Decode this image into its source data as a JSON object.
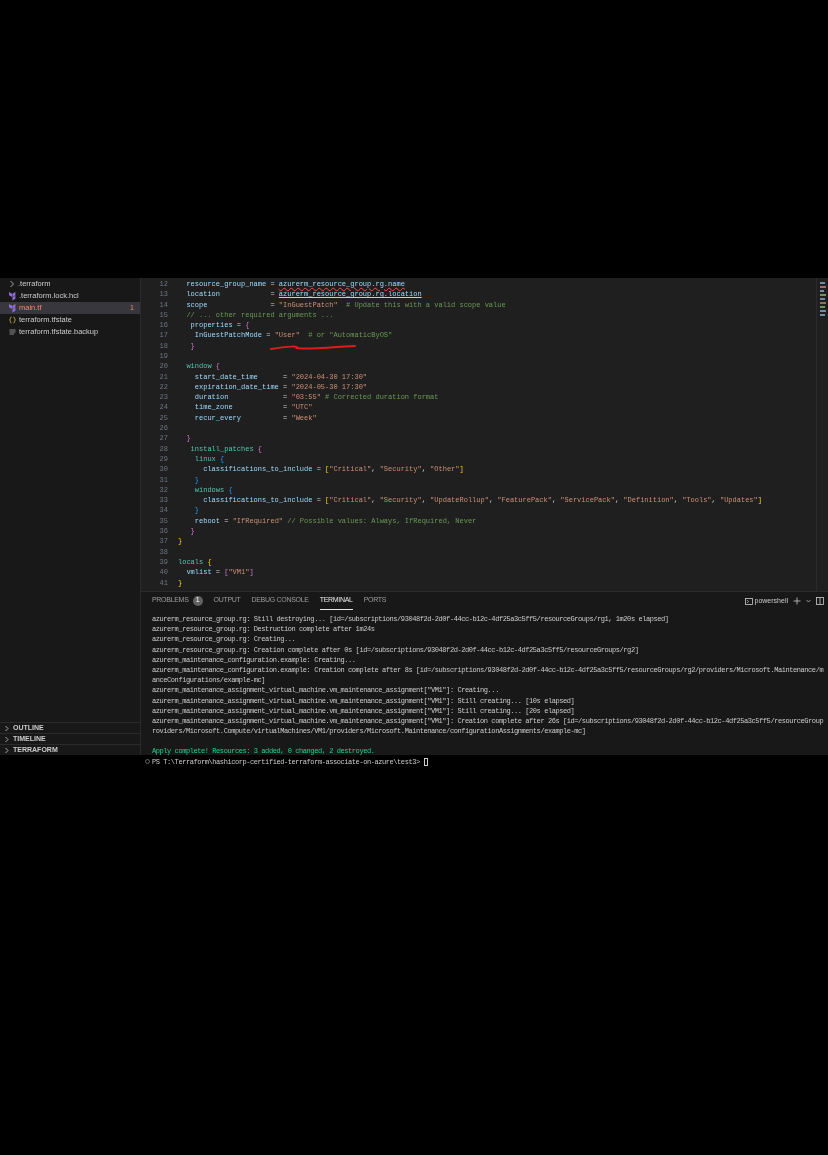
{
  "explorer": {
    "items": [
      {
        "name": ".terraform",
        "kind": "folder",
        "selected": false,
        "error": false
      },
      {
        "name": ".terraform.lock.hcl",
        "kind": "terraform",
        "selected": false,
        "error": false
      },
      {
        "name": "main.tf",
        "kind": "terraform",
        "selected": true,
        "error": true,
        "badge": "1"
      },
      {
        "name": "terraform.tfstate",
        "kind": "json",
        "selected": false,
        "error": false
      },
      {
        "name": "terraform.tfstate.backup",
        "kind": "text",
        "selected": false,
        "error": false
      }
    ]
  },
  "sections": [
    {
      "label": "OUTLINE",
      "expanded": false
    },
    {
      "label": "TIMELINE",
      "expanded": false
    },
    {
      "label": "TERRAFORM",
      "expanded": false
    }
  ],
  "editor": {
    "lines": [
      {
        "number": "12",
        "tokens": [
          {
            "kind": "attr",
            "text": "  resource_group_name "
          },
          {
            "kind": "op",
            "text": "= "
          },
          {
            "kind": "ref_error",
            "text": "azurerm_resource_group.rg.name"
          }
        ]
      },
      {
        "number": "13",
        "tokens": [
          {
            "kind": "attr",
            "text": "  location            "
          },
          {
            "kind": "op",
            "text": "= "
          },
          {
            "kind": "ref",
            "text": "azurerm_resource_group.rg.location"
          }
        ]
      },
      {
        "number": "14",
        "tokens": [
          {
            "kind": "attr",
            "text": "  scope               "
          },
          {
            "kind": "op",
            "text": "= "
          },
          {
            "kind": "string",
            "text": "\"InGuestPatch\""
          },
          {
            "kind": "comment",
            "text": "  # Update this with a valid scope value"
          }
        ]
      },
      {
        "number": "15",
        "tokens": [
          {
            "kind": "comment",
            "text": "  // ... other required arguments ..."
          }
        ]
      },
      {
        "number": "16",
        "tokens": [
          {
            "kind": "attr",
            "text": "   properties "
          },
          {
            "kind": "op",
            "text": "= "
          },
          {
            "kind": "brace2",
            "text": "{"
          }
        ]
      },
      {
        "number": "17",
        "tokens": [
          {
            "kind": "attr",
            "text": "    InGuestPatchMode "
          },
          {
            "kind": "op",
            "text": "= "
          },
          {
            "kind": "string",
            "text": "\"User\""
          },
          {
            "kind": "comment",
            "text": "  # or \"AutomaticByOS\""
          }
        ]
      },
      {
        "number": "18",
        "tokens": [
          {
            "kind": "brace2",
            "text": "   }"
          }
        ]
      },
      {
        "number": "19"
      },
      {
        "number": "20",
        "tokens": [
          {
            "kind": "block",
            "text": "  window "
          },
          {
            "kind": "brace2",
            "text": "{"
          }
        ]
      },
      {
        "number": "21",
        "tokens": [
          {
            "kind": "attr",
            "text": "    start_date_time      "
          },
          {
            "kind": "op",
            "text": "= "
          },
          {
            "kind": "string",
            "text": "\"2024-04-30 17:30\""
          }
        ]
      },
      {
        "number": "22",
        "tokens": [
          {
            "kind": "attr",
            "text": "    expiration_date_time "
          },
          {
            "kind": "op",
            "text": "= "
          },
          {
            "kind": "string",
            "text": "\"2024-05-30 17:30\""
          }
        ]
      },
      {
        "number": "23",
        "tokens": [
          {
            "kind": "attr",
            "text": "    duration             "
          },
          {
            "kind": "op",
            "text": "= "
          },
          {
            "kind": "string",
            "text": "\"03:55\""
          },
          {
            "kind": "comment",
            "text": " # Corrected duration format"
          }
        ]
      },
      {
        "number": "24",
        "tokens": [
          {
            "kind": "attr",
            "text": "    time_zone            "
          },
          {
            "kind": "op",
            "text": "= "
          },
          {
            "kind": "string",
            "text": "\"UTC\""
          }
        ]
      },
      {
        "number": "25",
        "tokens": [
          {
            "kind": "attr",
            "text": "    recur_every          "
          },
          {
            "kind": "op",
            "text": "= "
          },
          {
            "kind": "string",
            "text": "\"Week\""
          }
        ]
      },
      {
        "number": "26"
      },
      {
        "number": "27",
        "tokens": [
          {
            "kind": "brace2",
            "text": "  }"
          }
        ]
      },
      {
        "number": "28",
        "tokens": [
          {
            "kind": "block",
            "text": "   install_patches "
          },
          {
            "kind": "brace2",
            "text": "{"
          }
        ]
      },
      {
        "number": "29",
        "tokens": [
          {
            "kind": "block",
            "text": "    linux "
          },
          {
            "kind": "brace3",
            "text": "{"
          }
        ]
      },
      {
        "number": "30",
        "tokens": [
          {
            "kind": "attr",
            "text": "      classifications_to_include "
          },
          {
            "kind": "op",
            "text": "= "
          },
          {
            "kind": "brace1",
            "text": "["
          },
          {
            "kind": "string",
            "text": "\"Critical\""
          },
          {
            "kind": "op",
            "text": ", "
          },
          {
            "kind": "string",
            "text": "\"Security\""
          },
          {
            "kind": "op",
            "text": ", "
          },
          {
            "kind": "string",
            "text": "\"Other\""
          },
          {
            "kind": "brace1",
            "text": "]"
          }
        ]
      },
      {
        "number": "31",
        "tokens": [
          {
            "kind": "brace3",
            "text": "    }"
          }
        ]
      },
      {
        "number": "32",
        "tokens": [
          {
            "kind": "block",
            "text": "    windows "
          },
          {
            "kind": "brace3",
            "text": "{"
          }
        ]
      },
      {
        "number": "33",
        "tokens": [
          {
            "kind": "attr",
            "text": "      classifications_to_include "
          },
          {
            "kind": "op",
            "text": "= "
          },
          {
            "kind": "brace1",
            "text": "["
          },
          {
            "kind": "string",
            "text": "\"Critical\""
          },
          {
            "kind": "op",
            "text": ", "
          },
          {
            "kind": "string",
            "text": "\"Security\""
          },
          {
            "kind": "op",
            "text": ", "
          },
          {
            "kind": "string",
            "text": "\"UpdateRollup\""
          },
          {
            "kind": "op",
            "text": ", "
          },
          {
            "kind": "string",
            "text": "\"FeaturePack\""
          },
          {
            "kind": "op",
            "text": ", "
          },
          {
            "kind": "string",
            "text": "\"ServicePack\""
          },
          {
            "kind": "op",
            "text": ", "
          },
          {
            "kind": "string",
            "text": "\"Definition\""
          },
          {
            "kind": "op",
            "text": ", "
          },
          {
            "kind": "string",
            "text": "\"Tools\""
          },
          {
            "kind": "op",
            "text": ", "
          },
          {
            "kind": "string",
            "text": "\"Updates\""
          },
          {
            "kind": "brace1",
            "text": "]"
          }
        ]
      },
      {
        "number": "34",
        "tokens": [
          {
            "kind": "brace3",
            "text": "    }"
          }
        ]
      },
      {
        "number": "35",
        "tokens": [
          {
            "kind": "attr",
            "text": "    reboot "
          },
          {
            "kind": "op",
            "text": "= "
          },
          {
            "kind": "string",
            "text": "\"IfRequired\""
          },
          {
            "kind": "comment",
            "text": " // Possible values: Always, IfRequired, Never"
          }
        ]
      },
      {
        "number": "36",
        "tokens": [
          {
            "kind": "brace2",
            "text": "   }"
          }
        ]
      },
      {
        "number": "37",
        "tokens": [
          {
            "kind": "brace1",
            "text": "}"
          }
        ]
      },
      {
        "number": "38"
      },
      {
        "number": "39",
        "tokens": [
          {
            "kind": "block",
            "text": "locals "
          },
          {
            "kind": "brace1",
            "text": "{"
          }
        ]
      },
      {
        "number": "40",
        "tokens": [
          {
            "kind": "attr",
            "text": "  vmlist "
          },
          {
            "kind": "op",
            "text": "= "
          },
          {
            "kind": "brace2",
            "text": "["
          },
          {
            "kind": "string",
            "text": "\"VM1\""
          },
          {
            "kind": "brace2",
            "text": "]"
          }
        ]
      },
      {
        "number": "41",
        "tokens": [
          {
            "kind": "brace1",
            "text": "}"
          }
        ]
      }
    ]
  },
  "panel": {
    "tabs": [
      {
        "label": "PROBLEMS",
        "badge": "1",
        "selected": false
      },
      {
        "label": "OUTPUT",
        "selected": false
      },
      {
        "label": "DEBUG CONSOLE",
        "selected": false
      },
      {
        "label": "TERMINAL",
        "selected": true
      },
      {
        "label": "PORTS",
        "selected": false
      }
    ],
    "shell": "powershell",
    "terminal_lines": [
      {
        "kind": "output",
        "text": "azurerm_resource_group.rg: Still destroying... [id=/subscriptions/93048f2d-2d0f-44cc-b12c-4df25a3c5ff5/resourceGroups/rg1, 1m20s elapsed]"
      },
      {
        "kind": "output",
        "text": "azurerm_resource_group.rg: Destruction complete after 1m24s"
      },
      {
        "kind": "output",
        "text": "azurerm_resource_group.rg: Creating..."
      },
      {
        "kind": "output",
        "text": "azurerm_resource_group.rg: Creation complete after 0s [id=/subscriptions/93048f2d-2d0f-44cc-b12c-4df25a3c5ff5/resourceGroups/rg2]"
      },
      {
        "kind": "output",
        "text": "azurerm_maintenance_configuration.example: Creating..."
      },
      {
        "kind": "output",
        "text": "azurerm_maintenance_configuration.example: Creation complete after 8s [id=/subscriptions/93048f2d-2d0f-44cc-b12c-4df25a3c5ff5/resourceGroups/rg2/providers/Microsoft.Maintenance/m"
      },
      {
        "kind": "output",
        "text": "anceConfigurations/example-mc]"
      },
      {
        "kind": "output",
        "text": "azurerm_maintenance_assignment_virtual_machine.vm_maintenance_assignment[\"VM1\"]: Creating..."
      },
      {
        "kind": "output",
        "text": "azurerm_maintenance_assignment_virtual_machine.vm_maintenance_assignment[\"VM1\"]: Still creating... [10s elapsed]"
      },
      {
        "kind": "output",
        "text": "azurerm_maintenance_assignment_virtual_machine.vm_maintenance_assignment[\"VM1\"]: Still creating... [20s elapsed]"
      },
      {
        "kind": "output",
        "text": "azurerm_maintenance_assignment_virtual_machine.vm_maintenance_assignment[\"VM1\"]: Creation complete after 26s [id=/subscriptions/93048f2d-2d0f-44cc-b12c-4df25a3c5ff5/resourceGroup"
      },
      {
        "kind": "output",
        "text": "roviders/Microsoft.Compute/virtualMachines/VM1/providers/Microsoft.Maintenance/configurationAssignments/example-mc]"
      },
      {
        "kind": "blank"
      },
      {
        "kind": "success",
        "text": "Apply complete! Resources: 3 added, 0 changed, 2 destroyed."
      },
      {
        "kind": "prompt",
        "text": "PS T:\\Terraform\\hashicorp-certified-terraform-associate-on-azure\\test3> "
      }
    ]
  }
}
